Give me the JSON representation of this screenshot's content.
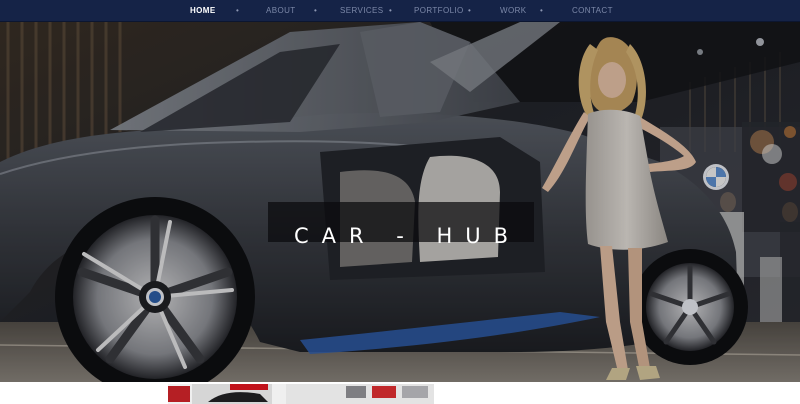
{
  "nav": {
    "items": [
      {
        "label": "HOME",
        "active": true
      },
      {
        "label": "ABOUT",
        "active": false
      },
      {
        "label": "SERVICES",
        "active": false
      },
      {
        "label": "PORTFOLIO",
        "active": false
      },
      {
        "label": "WORK",
        "active": false
      },
      {
        "label": "CONTACT",
        "active": false
      }
    ],
    "separator": "•",
    "colors": {
      "bar": "#152347",
      "active": "#ffffff",
      "inactive": "#7c88a8"
    }
  },
  "hero": {
    "title": "CAR - HUB",
    "image": "car-show-photo"
  },
  "below": {
    "image": "car-gallery-thumbnail"
  }
}
